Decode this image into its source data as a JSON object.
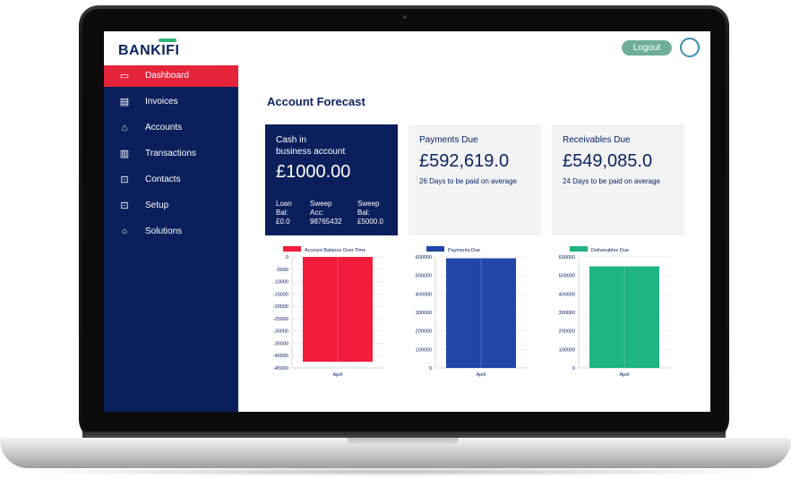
{
  "app": {
    "logo": "BANKIFI",
    "logout_label": "Logout"
  },
  "sidebar": {
    "items": [
      {
        "label": "Dashboard",
        "icon": "monitor-icon",
        "active": true
      },
      {
        "label": "Invoices",
        "icon": "invoice-icon",
        "active": false
      },
      {
        "label": "Accounts",
        "icon": "bank-icon",
        "active": false
      },
      {
        "label": "Transactions",
        "icon": "transactions-icon",
        "active": false
      },
      {
        "label": "Contacts",
        "icon": "lock-icon",
        "active": false
      },
      {
        "label": "Setup",
        "icon": "lock-icon",
        "active": false
      },
      {
        "label": "Solutions",
        "icon": "circle-icon",
        "active": false
      }
    ]
  },
  "main": {
    "title": "Account Forecast",
    "cards": {
      "cash": {
        "title": "Cash in\nbusiness account",
        "amount": "£1000.00",
        "loan": "Loan\nBal:\n£0.0",
        "sweep_acc": "Sweep\nAcc:\n98765432",
        "sweep_bal": "Sweep\nBal:\n£5000.0"
      },
      "payments": {
        "title": "Payments Due",
        "amount": "£592,619.0",
        "sub": "26 Days to be paid on average"
      },
      "receivables": {
        "title": "Receivables Due",
        "amount": "£549,085.0",
        "sub": "24 Days to be paid on average"
      }
    }
  },
  "chart_data": [
    {
      "type": "bar",
      "categories": [
        "April"
      ],
      "series": [
        {
          "name": "Account Balance Over Time",
          "values": [
            -42500
          ]
        }
      ],
      "ylim": [
        -45000,
        0
      ],
      "yticks": [
        0,
        -5000,
        -10000,
        -15000,
        -20000,
        -25000,
        -30000,
        -35000,
        -40000,
        -45000
      ],
      "color": "#f21c3c"
    },
    {
      "type": "bar",
      "categories": [
        "April"
      ],
      "series": [
        {
          "name": "Payments Due",
          "values": [
            592619
          ]
        }
      ],
      "ylim": [
        0,
        600000
      ],
      "yticks": [
        0,
        100000,
        200000,
        300000,
        400000,
        500000,
        600000
      ],
      "color": "#1f46a8"
    },
    {
      "type": "bar",
      "categories": [
        "April"
      ],
      "series": [
        {
          "name": "Deliverables Due",
          "values": [
            549085
          ]
        }
      ],
      "ylim": [
        0,
        600000
      ],
      "yticks": [
        0,
        100000,
        200000,
        300000,
        400000,
        500000,
        600000
      ],
      "color": "#20b47e"
    }
  ]
}
